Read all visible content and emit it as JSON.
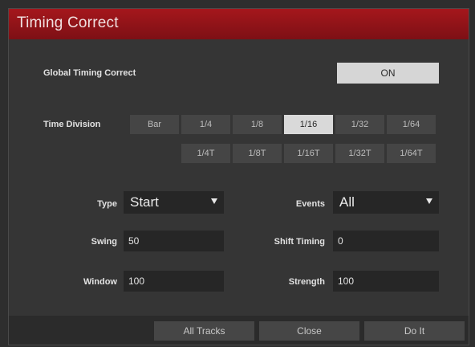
{
  "dialog": {
    "title": "Timing Correct"
  },
  "global_timing_correct": {
    "label": "Global Timing Correct",
    "toggle_label": "ON"
  },
  "time_division": {
    "label": "Time Division",
    "row1": [
      "Bar",
      "1/4",
      "1/8",
      "1/16",
      "1/32",
      "1/64"
    ],
    "row2": [
      "1/4T",
      "1/8T",
      "1/16T",
      "1/32T",
      "1/64T"
    ],
    "selected": "1/16"
  },
  "type": {
    "label": "Type",
    "value": "Start"
  },
  "events": {
    "label": "Events",
    "value": "All"
  },
  "swing": {
    "label": "Swing",
    "value": "50"
  },
  "shift_timing": {
    "label": "Shift Timing",
    "value": "0"
  },
  "window": {
    "label": "Window",
    "value": "100"
  },
  "strength": {
    "label": "Strength",
    "value": "100"
  },
  "footer": {
    "all_tracks": "All Tracks",
    "close": "Close",
    "do_it": "Do It"
  }
}
